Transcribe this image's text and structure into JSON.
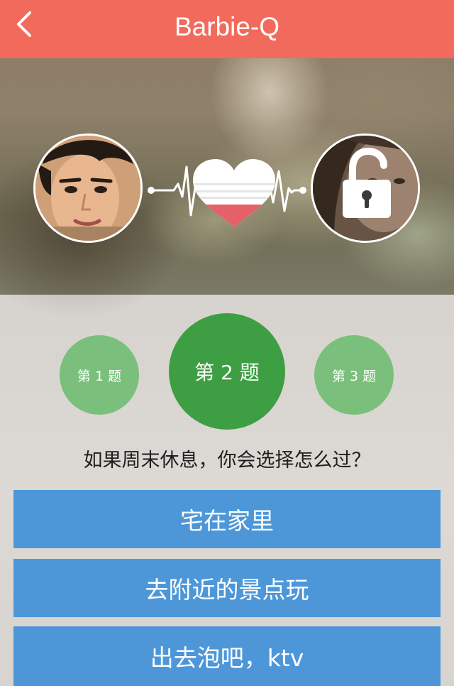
{
  "header": {
    "title": "Barbie-Q",
    "back_icon": "chevron-left-icon"
  },
  "match": {
    "left_avatar": "male-avatar-photo",
    "right_avatar": "female-avatar-photo",
    "right_avatar_overlay_icon": "lock-open-icon",
    "center_icon": "heart-icon",
    "heartbeat_icon": "heartbeat-line-icon",
    "heart_fill_color": "#e5616a",
    "heart_fill_level": 0.25
  },
  "steps": [
    {
      "label": "第 1 题",
      "active": false
    },
    {
      "label": "第 2 题",
      "active": true
    },
    {
      "label": "第 3 题",
      "active": false
    }
  ],
  "question": {
    "text": "如果周末休息，你会选择怎么过？"
  },
  "options": [
    {
      "label": "宅在家里"
    },
    {
      "label": "去附近的景点玩"
    },
    {
      "label": "出去泡吧，ktv"
    }
  ],
  "colors": {
    "header_bg": "#f26a5c",
    "step_active": "#3e9e43",
    "step_inactive": "#7ac07c",
    "option_bg": "#4d97d9"
  }
}
